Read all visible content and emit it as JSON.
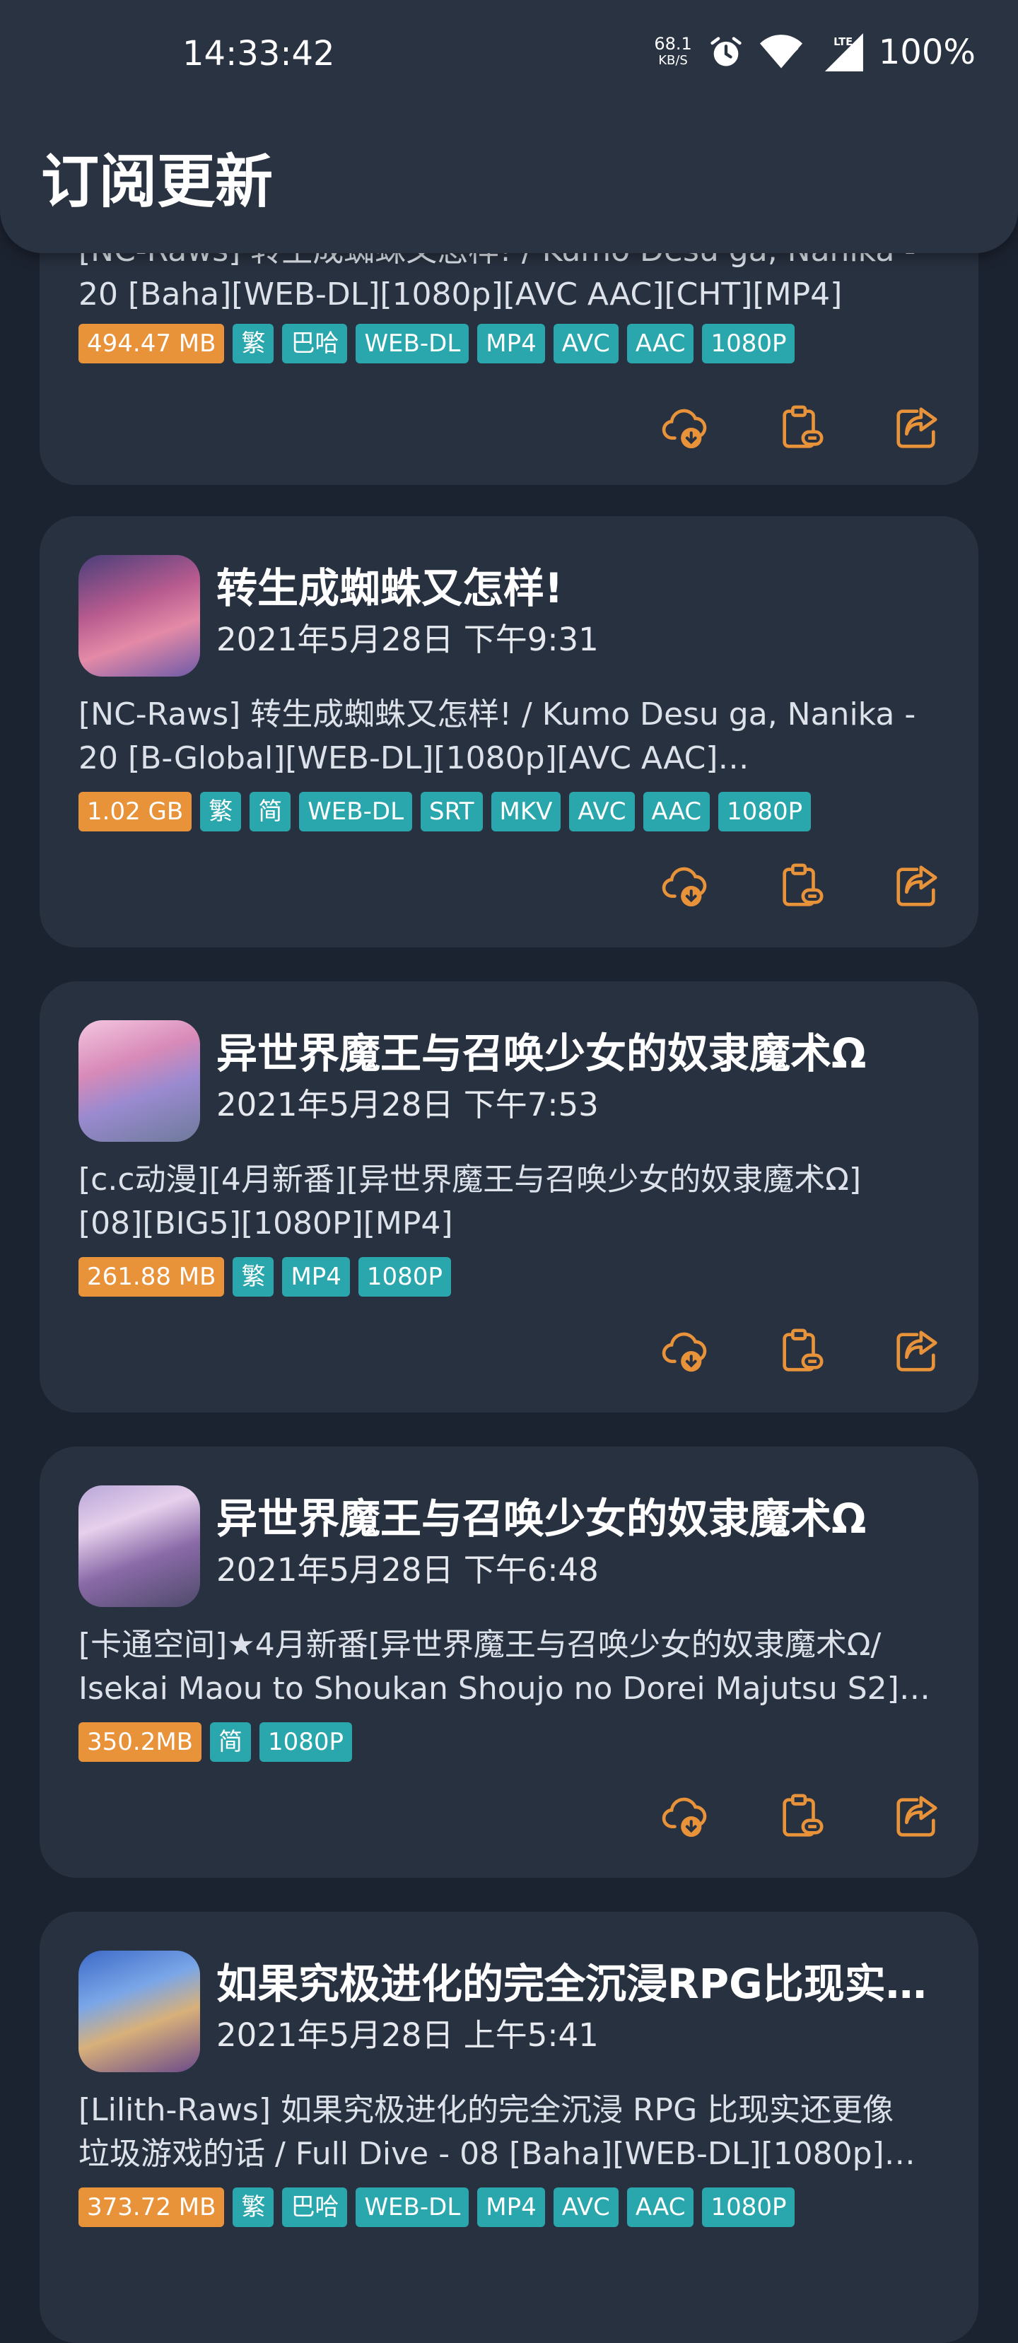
{
  "status_bar": {
    "time": "14:33:42",
    "net_speed": "68.1",
    "net_unit": "KB/S",
    "battery": "100%",
    "icons": [
      "alarm-icon",
      "wifi-icon",
      "lte-signal-icon"
    ]
  },
  "header": {
    "title": "订阅更新"
  },
  "colors": {
    "background": "#1c2330",
    "card": "#283140",
    "accent": "#e8923a",
    "tag": "#2aa6ad"
  },
  "cards": [
    {
      "title": "",
      "date": "",
      "desc_lines": [
        "[NC-Raws] 转生成蜘蛛又怎样! / Kumo Desu ga, Nanika -",
        "20 [Baha][WEB-DL][1080p][AVC AAC][CHT][MP4]"
      ],
      "size": "494.47 MB",
      "tags": [
        "繁",
        "巴哈",
        "WEB-DL",
        "MP4",
        "AVC",
        "AAC",
        "1080P"
      ]
    },
    {
      "title": "转生成蜘蛛又怎样!",
      "date": "2021年5月28日 下午9:31",
      "desc_lines": [
        "[NC-Raws] 转生成蜘蛛又怎样! / Kumo Desu ga, Nanika -",
        "20 [B-Global][WEB-DL][1080p][AVC AAC]…"
      ],
      "size": "1.02 GB",
      "tags": [
        "繁",
        "简",
        "WEB-DL",
        "SRT",
        "MKV",
        "AVC",
        "AAC",
        "1080P"
      ]
    },
    {
      "title": "异世界魔王与召唤少女的奴隶魔术Ω",
      "date": "2021年5月28日 下午7:53",
      "desc_lines": [
        "[c.c动漫][4月新番][异世界魔王与召唤少女的奴隶魔术Ω]",
        "[08][BIG5][1080P][MP4]"
      ],
      "size": "261.88 MB",
      "tags": [
        "繁",
        "MP4",
        "1080P"
      ]
    },
    {
      "title": "异世界魔王与召唤少女的奴隶魔术Ω",
      "date": "2021年5月28日 下午6:48",
      "desc_lines": [
        "[卡通空间]★4月新番[异世界魔王与召唤少女的奴隶魔术Ω/",
        "Isekai Maou to Shoukan Shoujo no Dorei Majutsu S2]…"
      ],
      "size": "350.2MB",
      "tags": [
        "简",
        "1080P"
      ]
    },
    {
      "title": "如果究极进化的完全沉浸RPG比现实还更像垃圾游戏的话",
      "date": "2021年5月28日 上午5:41",
      "desc_lines": [
        "[Lilith-Raws] 如果究极进化的完全沉浸 RPG 比现实还更像",
        "垃圾游戏的话 / Full Dive - 08 [Baha][WEB-DL][1080p]…"
      ],
      "size": "373.72 MB",
      "tags": [
        "繁",
        "巴哈",
        "WEB-DL",
        "MP4",
        "AVC",
        "AAC",
        "1080P"
      ]
    }
  ]
}
